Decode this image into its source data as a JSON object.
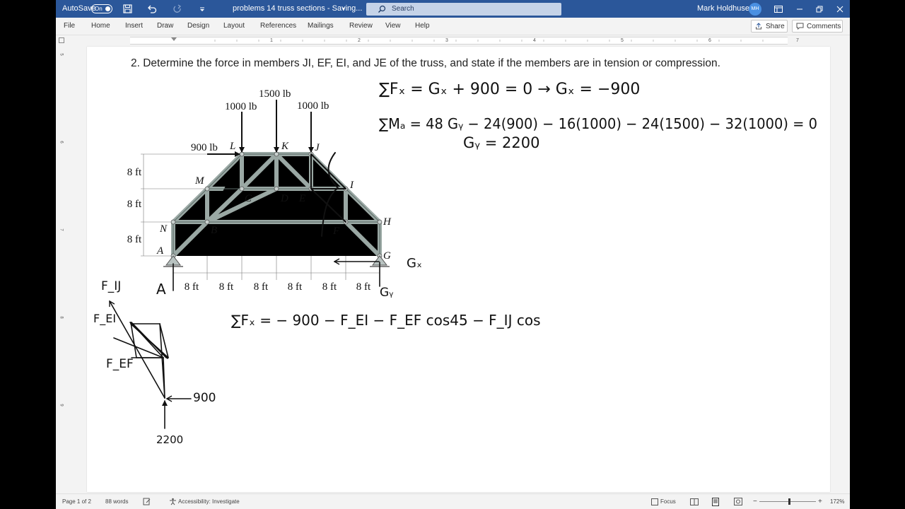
{
  "titlebar": {
    "autosave_label": "AutoSave",
    "autosave_state": "On",
    "document_title": "problems 14 truss sections  -  Saving...",
    "search_placeholder": "Search",
    "user_name": "Mark Holdhusen",
    "user_initials": "MH",
    "bg_color": "#2b579a"
  },
  "menu": {
    "items": [
      "File",
      "Home",
      "Insert",
      "Draw",
      "Design",
      "Layout",
      "References",
      "Mailings",
      "Review",
      "View",
      "Help"
    ],
    "share_label": "Share",
    "comments_label": "Comments"
  },
  "ruler": {
    "numbers": [
      "1",
      "2",
      "3",
      "4",
      "5",
      "6",
      "7"
    ],
    "vertical_numbers": [
      "5",
      "6",
      "7",
      "8",
      "9"
    ]
  },
  "document": {
    "question": "2. Determine the force in members JI, EF, EI, and JE of the truss, and state if the members are in tension or compression.",
    "figure": {
      "loads": {
        "p1500": "1500 lb",
        "p1000a": "1000 lb",
        "p1000b": "1000 lb",
        "p900": "900 lb"
      },
      "dims": {
        "h1": "8 ft",
        "h2": "8 ft",
        "h3": "8 ft",
        "w": [
          "8 ft",
          "8 ft",
          "8 ft",
          "8 ft",
          "8 ft",
          "8 ft"
        ]
      },
      "nodes": [
        "L",
        "K",
        "J",
        "M",
        "I",
        "C",
        "D",
        "E",
        "N",
        "B",
        "F",
        "H",
        "A",
        "G"
      ]
    },
    "handwriting": {
      "eq_sum_fx": "∑Fₓ = Gₓ + 900 = 0 → Gₓ = −900",
      "eq_sum_ma": "∑Mₐ = 48 Gᵧ − 24(900) − 16(1000) − 24(1500) − 32(1000) = 0",
      "eq_gy": "Gᵧ = 2200",
      "support_a": "A",
      "support_gx": "Gₓ",
      "support_gy": "Gᵧ",
      "eq_fbd_fx": "∑Fₓ = − 900 − F_EI − F_EF cos45 − F_IJ cos",
      "fbd": {
        "fij": "F_IJ",
        "fei": "F_EI",
        "fef": "F_EF",
        "load_900": "900",
        "load_2200": "2200"
      }
    }
  },
  "status": {
    "page": "Page 1 of 2",
    "words": "88 words",
    "accessibility": "Accessibility: Investigate",
    "focus": "Focus",
    "zoom": "172%"
  }
}
